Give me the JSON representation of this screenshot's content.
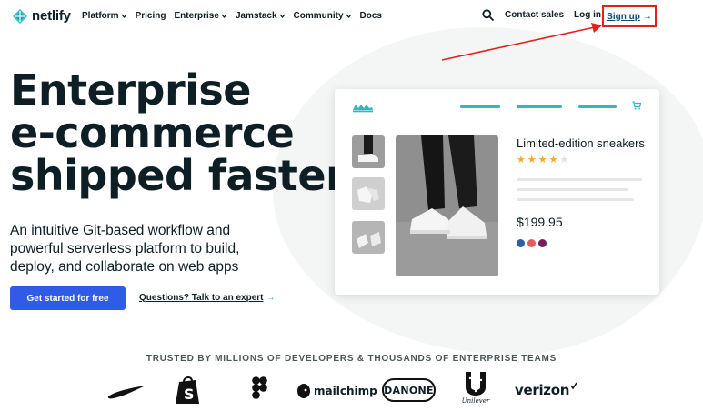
{
  "brand": {
    "name": "netlify"
  },
  "nav": {
    "items": [
      {
        "label": "Platform",
        "dropdown": true
      },
      {
        "label": "Pricing",
        "dropdown": false
      },
      {
        "label": "Enterprise",
        "dropdown": true
      },
      {
        "label": "Jamstack",
        "dropdown": true
      },
      {
        "label": "Community",
        "dropdown": true
      },
      {
        "label": "Docs",
        "dropdown": false
      }
    ],
    "contact_sales": "Contact sales",
    "log_in": "Log in",
    "sign_up": "Sign up",
    "sign_up_arrow": "→"
  },
  "hero": {
    "title_lines": [
      "Enterprise",
      "e-commerce",
      "shipped faster"
    ],
    "subtitle": "An intuitive Git-based workflow and powerful serverless platform to build, deploy, and collaborate on web apps",
    "cta_label": "Get started for free",
    "expert_link": "Questions? Talk to an expert",
    "expert_arrow": "→"
  },
  "product_card": {
    "title": "Limited-edition sneakers",
    "rating": 4,
    "rating_max": 5,
    "price": "$199.95",
    "swatch_colors": [
      "#2b5fa6",
      "#e85a5a",
      "#7d1b5f"
    ]
  },
  "trusted": {
    "heading": "TRUSTED BY MILLIONS OF DEVELOPERS & THOUSANDS OF ENTERPRISE TEAMS",
    "logos": [
      "nike",
      "shopify",
      "figma",
      "mailchimp",
      "DANONE",
      "Unilever",
      "verizon"
    ]
  },
  "colors": {
    "accent": "#2f5be6",
    "teal": "#2fb8bd",
    "annotation": "#e2211c"
  }
}
